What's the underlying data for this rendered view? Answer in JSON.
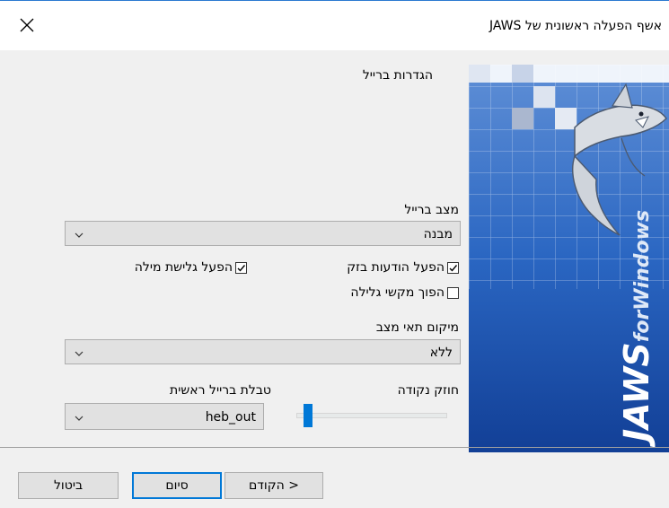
{
  "window": {
    "title": "אשף הפעלה ראשונית של JAWS",
    "close_icon": "close-icon"
  },
  "heading": "הגדרות ברייל",
  "braille_mode": {
    "label": "מצב ברייל",
    "value": "מבנה"
  },
  "checkboxes": {
    "flash_messages": {
      "label": "הפעל הודעות בזק",
      "checked": true
    },
    "word_wrap": {
      "label": "הפעל גלישת מילה",
      "checked": true
    },
    "reverse_panning": {
      "label": "הפוך מקשי גלילה",
      "checked": false
    }
  },
  "status_cells": {
    "label": "מיקום תאי מצב",
    "value": "ללא"
  },
  "dot_strength": {
    "label": "חוזק נקודה",
    "level": 0.05
  },
  "main_table": {
    "label": "טבלת ברייל ראשית",
    "value": "heb_out"
  },
  "buttons": {
    "cancel": "ביטול",
    "finish": "סיום",
    "back": "< הקודם"
  },
  "banner": {
    "logo_text": "JAWS",
    "logo_suffix": "forWindows",
    "accent": "#1d5fb8"
  }
}
